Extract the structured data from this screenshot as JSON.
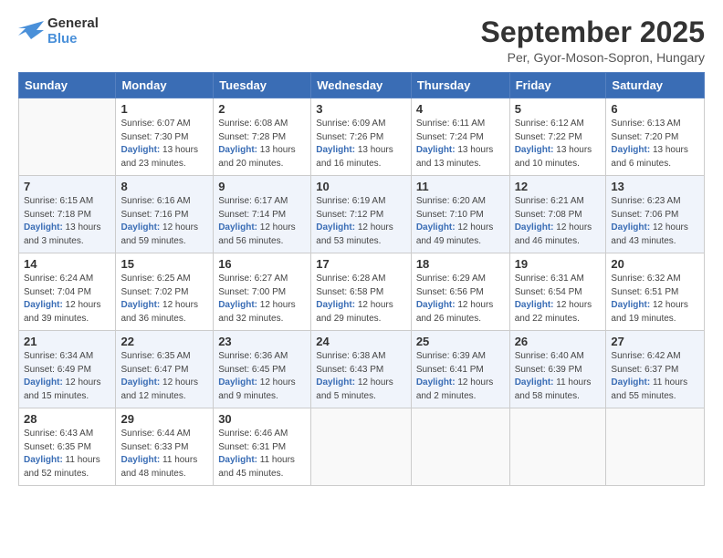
{
  "header": {
    "logo_line1": "General",
    "logo_line2": "Blue",
    "month": "September 2025",
    "location": "Per, Gyor-Moson-Sopron, Hungary"
  },
  "weekdays": [
    "Sunday",
    "Monday",
    "Tuesday",
    "Wednesday",
    "Thursday",
    "Friday",
    "Saturday"
  ],
  "weeks": [
    [
      {
        "day": "",
        "sunrise": "",
        "sunset": "",
        "daylight": ""
      },
      {
        "day": "1",
        "sunrise": "Sunrise: 6:07 AM",
        "sunset": "Sunset: 7:30 PM",
        "daylight": "Daylight: 13 hours and 23 minutes."
      },
      {
        "day": "2",
        "sunrise": "Sunrise: 6:08 AM",
        "sunset": "Sunset: 7:28 PM",
        "daylight": "Daylight: 13 hours and 20 minutes."
      },
      {
        "day": "3",
        "sunrise": "Sunrise: 6:09 AM",
        "sunset": "Sunset: 7:26 PM",
        "daylight": "Daylight: 13 hours and 16 minutes."
      },
      {
        "day": "4",
        "sunrise": "Sunrise: 6:11 AM",
        "sunset": "Sunset: 7:24 PM",
        "daylight": "Daylight: 13 hours and 13 minutes."
      },
      {
        "day": "5",
        "sunrise": "Sunrise: 6:12 AM",
        "sunset": "Sunset: 7:22 PM",
        "daylight": "Daylight: 13 hours and 10 minutes."
      },
      {
        "day": "6",
        "sunrise": "Sunrise: 6:13 AM",
        "sunset": "Sunset: 7:20 PM",
        "daylight": "Daylight: 13 hours and 6 minutes."
      }
    ],
    [
      {
        "day": "7",
        "sunrise": "Sunrise: 6:15 AM",
        "sunset": "Sunset: 7:18 PM",
        "daylight": "Daylight: 13 hours and 3 minutes."
      },
      {
        "day": "8",
        "sunrise": "Sunrise: 6:16 AM",
        "sunset": "Sunset: 7:16 PM",
        "daylight": "Daylight: 12 hours and 59 minutes."
      },
      {
        "day": "9",
        "sunrise": "Sunrise: 6:17 AM",
        "sunset": "Sunset: 7:14 PM",
        "daylight": "Daylight: 12 hours and 56 minutes."
      },
      {
        "day": "10",
        "sunrise": "Sunrise: 6:19 AM",
        "sunset": "Sunset: 7:12 PM",
        "daylight": "Daylight: 12 hours and 53 minutes."
      },
      {
        "day": "11",
        "sunrise": "Sunrise: 6:20 AM",
        "sunset": "Sunset: 7:10 PM",
        "daylight": "Daylight: 12 hours and 49 minutes."
      },
      {
        "day": "12",
        "sunrise": "Sunrise: 6:21 AM",
        "sunset": "Sunset: 7:08 PM",
        "daylight": "Daylight: 12 hours and 46 minutes."
      },
      {
        "day": "13",
        "sunrise": "Sunrise: 6:23 AM",
        "sunset": "Sunset: 7:06 PM",
        "daylight": "Daylight: 12 hours and 43 minutes."
      }
    ],
    [
      {
        "day": "14",
        "sunrise": "Sunrise: 6:24 AM",
        "sunset": "Sunset: 7:04 PM",
        "daylight": "Daylight: 12 hours and 39 minutes."
      },
      {
        "day": "15",
        "sunrise": "Sunrise: 6:25 AM",
        "sunset": "Sunset: 7:02 PM",
        "daylight": "Daylight: 12 hours and 36 minutes."
      },
      {
        "day": "16",
        "sunrise": "Sunrise: 6:27 AM",
        "sunset": "Sunset: 7:00 PM",
        "daylight": "Daylight: 12 hours and 32 minutes."
      },
      {
        "day": "17",
        "sunrise": "Sunrise: 6:28 AM",
        "sunset": "Sunset: 6:58 PM",
        "daylight": "Daylight: 12 hours and 29 minutes."
      },
      {
        "day": "18",
        "sunrise": "Sunrise: 6:29 AM",
        "sunset": "Sunset: 6:56 PM",
        "daylight": "Daylight: 12 hours and 26 minutes."
      },
      {
        "day": "19",
        "sunrise": "Sunrise: 6:31 AM",
        "sunset": "Sunset: 6:54 PM",
        "daylight": "Daylight: 12 hours and 22 minutes."
      },
      {
        "day": "20",
        "sunrise": "Sunrise: 6:32 AM",
        "sunset": "Sunset: 6:51 PM",
        "daylight": "Daylight: 12 hours and 19 minutes."
      }
    ],
    [
      {
        "day": "21",
        "sunrise": "Sunrise: 6:34 AM",
        "sunset": "Sunset: 6:49 PM",
        "daylight": "Daylight: 12 hours and 15 minutes."
      },
      {
        "day": "22",
        "sunrise": "Sunrise: 6:35 AM",
        "sunset": "Sunset: 6:47 PM",
        "daylight": "Daylight: 12 hours and 12 minutes."
      },
      {
        "day": "23",
        "sunrise": "Sunrise: 6:36 AM",
        "sunset": "Sunset: 6:45 PM",
        "daylight": "Daylight: 12 hours and 9 minutes."
      },
      {
        "day": "24",
        "sunrise": "Sunrise: 6:38 AM",
        "sunset": "Sunset: 6:43 PM",
        "daylight": "Daylight: 12 hours and 5 minutes."
      },
      {
        "day": "25",
        "sunrise": "Sunrise: 6:39 AM",
        "sunset": "Sunset: 6:41 PM",
        "daylight": "Daylight: 12 hours and 2 minutes."
      },
      {
        "day": "26",
        "sunrise": "Sunrise: 6:40 AM",
        "sunset": "Sunset: 6:39 PM",
        "daylight": "Daylight: 11 hours and 58 minutes."
      },
      {
        "day": "27",
        "sunrise": "Sunrise: 6:42 AM",
        "sunset": "Sunset: 6:37 PM",
        "daylight": "Daylight: 11 hours and 55 minutes."
      }
    ],
    [
      {
        "day": "28",
        "sunrise": "Sunrise: 6:43 AM",
        "sunset": "Sunset: 6:35 PM",
        "daylight": "Daylight: 11 hours and 52 minutes."
      },
      {
        "day": "29",
        "sunrise": "Sunrise: 6:44 AM",
        "sunset": "Sunset: 6:33 PM",
        "daylight": "Daylight: 11 hours and 48 minutes."
      },
      {
        "day": "30",
        "sunrise": "Sunrise: 6:46 AM",
        "sunset": "Sunset: 6:31 PM",
        "daylight": "Daylight: 11 hours and 45 minutes."
      },
      {
        "day": "",
        "sunrise": "",
        "sunset": "",
        "daylight": ""
      },
      {
        "day": "",
        "sunrise": "",
        "sunset": "",
        "daylight": ""
      },
      {
        "day": "",
        "sunrise": "",
        "sunset": "",
        "daylight": ""
      },
      {
        "day": "",
        "sunrise": "",
        "sunset": "",
        "daylight": ""
      }
    ]
  ]
}
